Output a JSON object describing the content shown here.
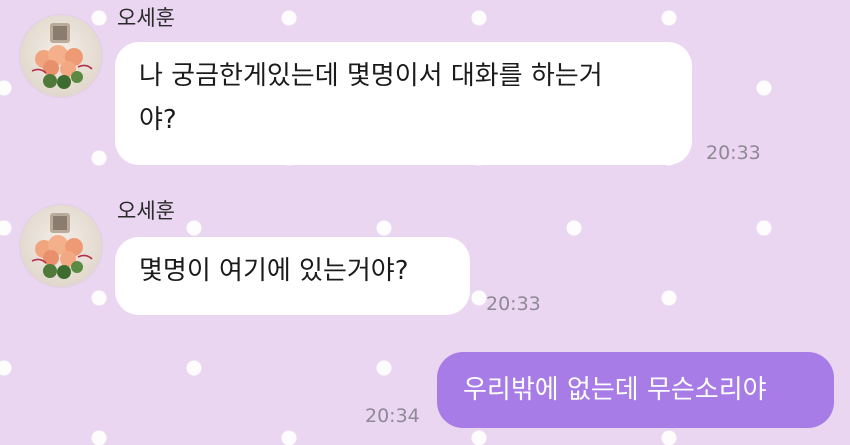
{
  "colors": {
    "background": "#ebd6f2",
    "received_bubble": "#ffffff",
    "sent_bubble": "#a77ce6",
    "timestamp": "#8f8895"
  },
  "messages": [
    {
      "direction": "received",
      "sender": "오세훈",
      "avatar_icon": "flower-bouquet-avatar-icon",
      "text": "나 궁금한게있는데 몇명이서 대화를 하는거야?",
      "lines": [
        "나 궁금한게있는데 몇명이서 대화를 하는거",
        "야?"
      ],
      "time": "20:33"
    },
    {
      "direction": "received",
      "sender": "오세훈",
      "avatar_icon": "flower-bouquet-avatar-icon",
      "text": "몇명이 여기에 있는거야?",
      "time": "20:33"
    },
    {
      "direction": "sent",
      "text": "우리밖에 없는데 무슨소리야",
      "time": "20:34"
    }
  ]
}
